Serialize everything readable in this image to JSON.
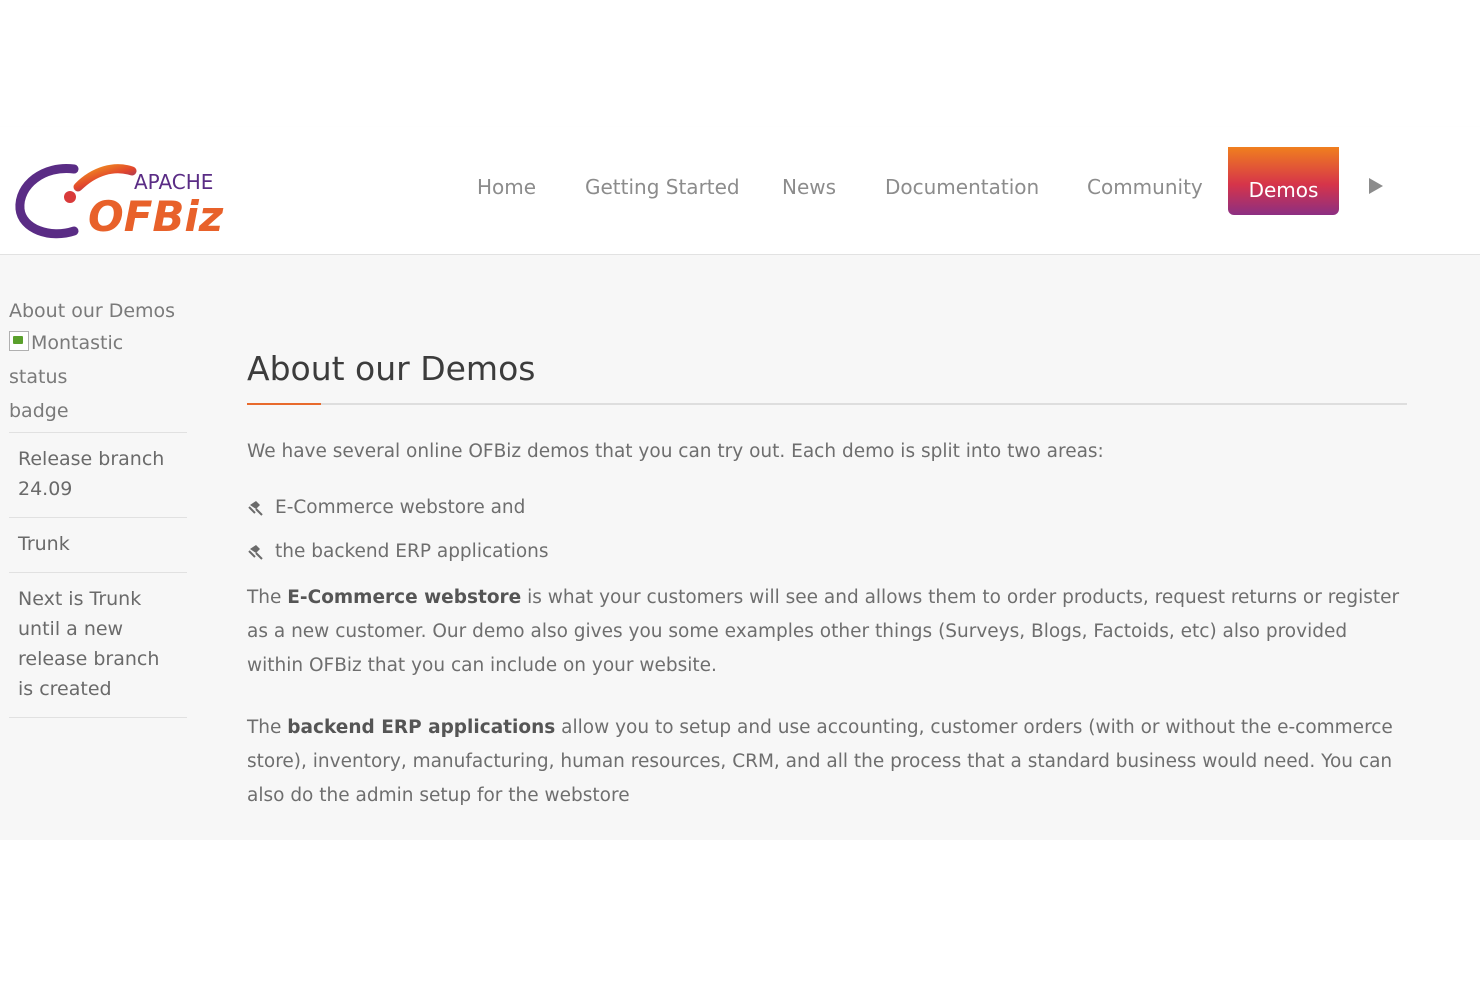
{
  "logo": {
    "top_text": "APACHE",
    "main_text": "OFBiz",
    "icon": "ofbiz-logo"
  },
  "nav": {
    "items": [
      {
        "label": "Home"
      },
      {
        "label": "Getting Started"
      },
      {
        "label": "News"
      },
      {
        "label": "Documentation"
      },
      {
        "label": "Community"
      },
      {
        "label": "Demos",
        "active": true
      }
    ],
    "more_icon": "play-arrow-icon"
  },
  "sidebar": {
    "title": "About our Demos",
    "badge_alt": "Montastic status badge",
    "badge_alt_line1": "Montastic status",
    "badge_alt_line2": "badge",
    "items": [
      {
        "label": "Release branch 24.09"
      },
      {
        "label": "Trunk"
      },
      {
        "label": "Next is Trunk until a new release branch is created"
      }
    ]
  },
  "main": {
    "title": "About our Demos",
    "intro": "We have several online OFBiz demos that you can try out. Each demo is split into two areas:",
    "bullets": [
      {
        "text": "E-Commerce webstore and",
        "icon": "thumbtack-icon"
      },
      {
        "text": "the backend ERP applications",
        "icon": "thumbtack-icon"
      }
    ],
    "para_ecommerce": {
      "prefix": "The ",
      "strong": "E-Commerce webstore",
      "rest": " is what your customers will see and allows them to order products, request returns or register as a new customer. Our demo also gives you some examples other things (Surveys, Blogs, Factoids, etc) also provided within OFBiz that you can include on your website."
    },
    "para_backend": {
      "prefix": "The ",
      "strong": "backend ERP applications",
      "rest": " allow you to setup and use accounting, customer orders (with or without the e-commerce store), inventory, manufacturing, human resources, CRM, and all the process that a standard business would need. You can also do the admin setup for the webstore"
    }
  },
  "colors": {
    "accent_orange": "#e86a2d",
    "demos_gradient_top": "#f07f1e",
    "demos_gradient_bottom": "#8c2f82",
    "band_background": "#f7f7f7"
  }
}
